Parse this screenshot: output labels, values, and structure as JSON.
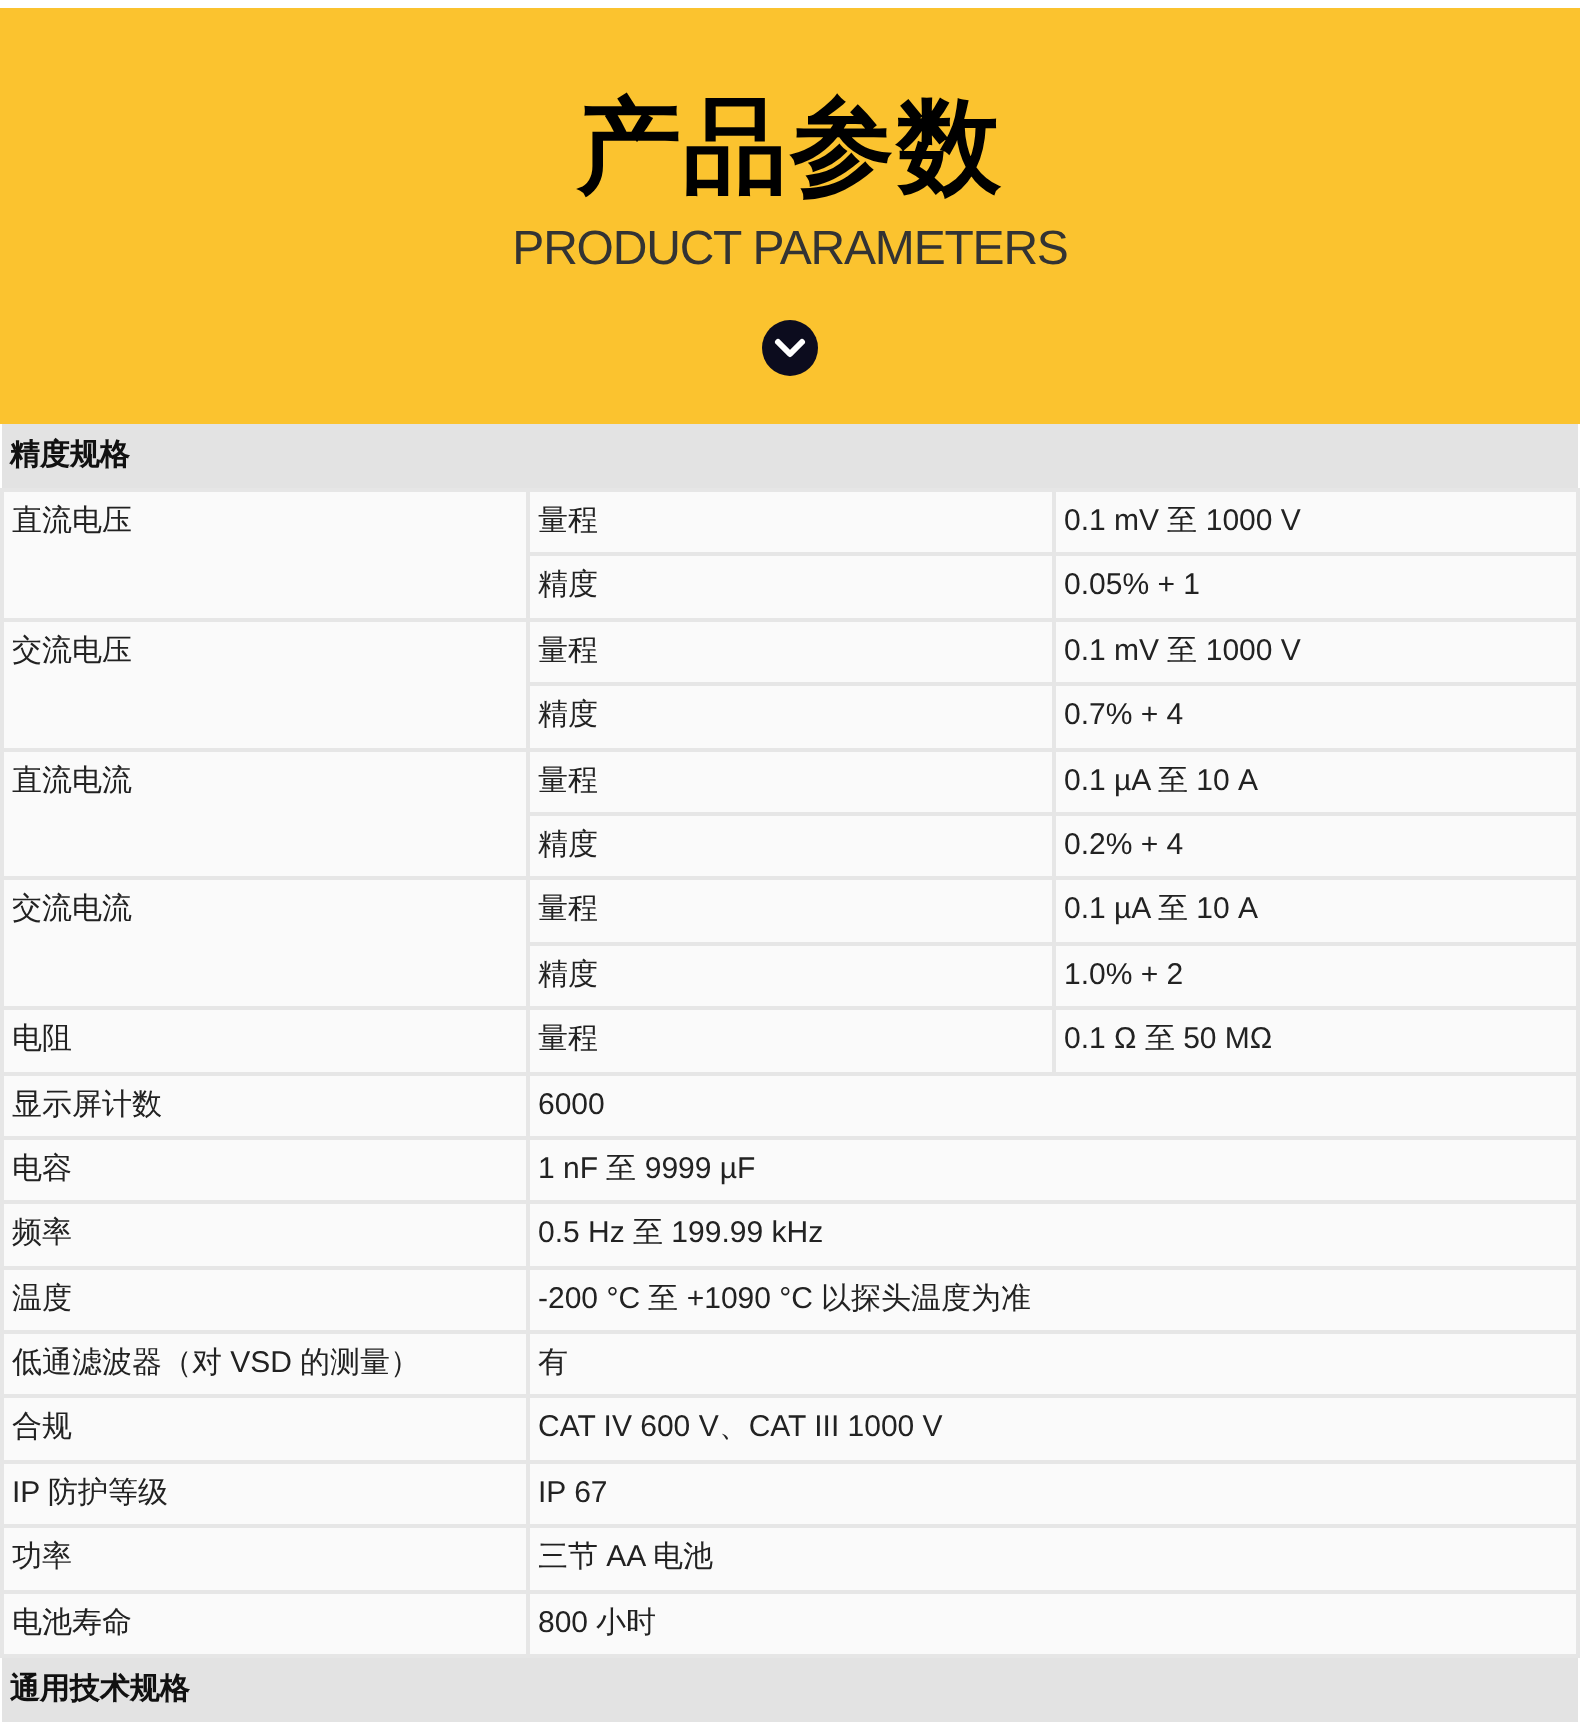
{
  "header": {
    "title": "产品参数",
    "subtitle": "PRODUCT PARAMETERS"
  },
  "sections": [
    {
      "title": "精度规格",
      "rows": [
        {
          "kind": "grouped",
          "label": "直流电压",
          "items": [
            {
              "name": "量程",
              "value": "0.1 mV 至 1000 V"
            },
            {
              "name": "精度",
              "value": "0.05% + 1"
            }
          ]
        },
        {
          "kind": "grouped",
          "label": "交流电压",
          "items": [
            {
              "name": "量程",
              "value": "0.1 mV 至 1000 V"
            },
            {
              "name": "精度",
              "value": "0.7% + 4"
            }
          ]
        },
        {
          "kind": "grouped",
          "label": "直流电流",
          "items": [
            {
              "name": "量程",
              "value": "0.1 µA 至 10 A"
            },
            {
              "name": "精度",
              "value": "0.2% + 4"
            }
          ]
        },
        {
          "kind": "grouped",
          "label": "交流电流",
          "items": [
            {
              "name": "量程",
              "value": "0.1 µA 至 10 A"
            },
            {
              "name": "精度",
              "value": "1.0% + 2"
            }
          ]
        },
        {
          "kind": "grouped",
          "label": "电阻",
          "items": [
            {
              "name": "量程",
              "value": "0.1 Ω 至 50 MΩ"
            }
          ]
        },
        {
          "kind": "simple",
          "label": "显示屏计数",
          "value": "6000"
        },
        {
          "kind": "simple",
          "label": "电容",
          "value": "1 nF 至 9999 µF"
        },
        {
          "kind": "simple",
          "label": "频率",
          "value": "0.5 Hz 至 199.99 kHz"
        },
        {
          "kind": "simple",
          "label": "温度",
          "value": "-200 °C 至 +1090 °C 以探头温度为准"
        },
        {
          "kind": "simple",
          "label": "低通滤波器（对 VSD 的测量）",
          "value": "有"
        },
        {
          "kind": "simple",
          "label": "合规",
          "value": "CAT IV 600 V、CAT III 1000 V"
        },
        {
          "kind": "simple",
          "label": "IP 防护等级",
          "value": "IP 67"
        },
        {
          "kind": "simple",
          "label": "功率",
          "value": "三节 AA 电池"
        },
        {
          "kind": "simple",
          "label": "电池寿命",
          "value": "800 小时"
        }
      ]
    },
    {
      "title": "通用技术规格"
    }
  ]
}
